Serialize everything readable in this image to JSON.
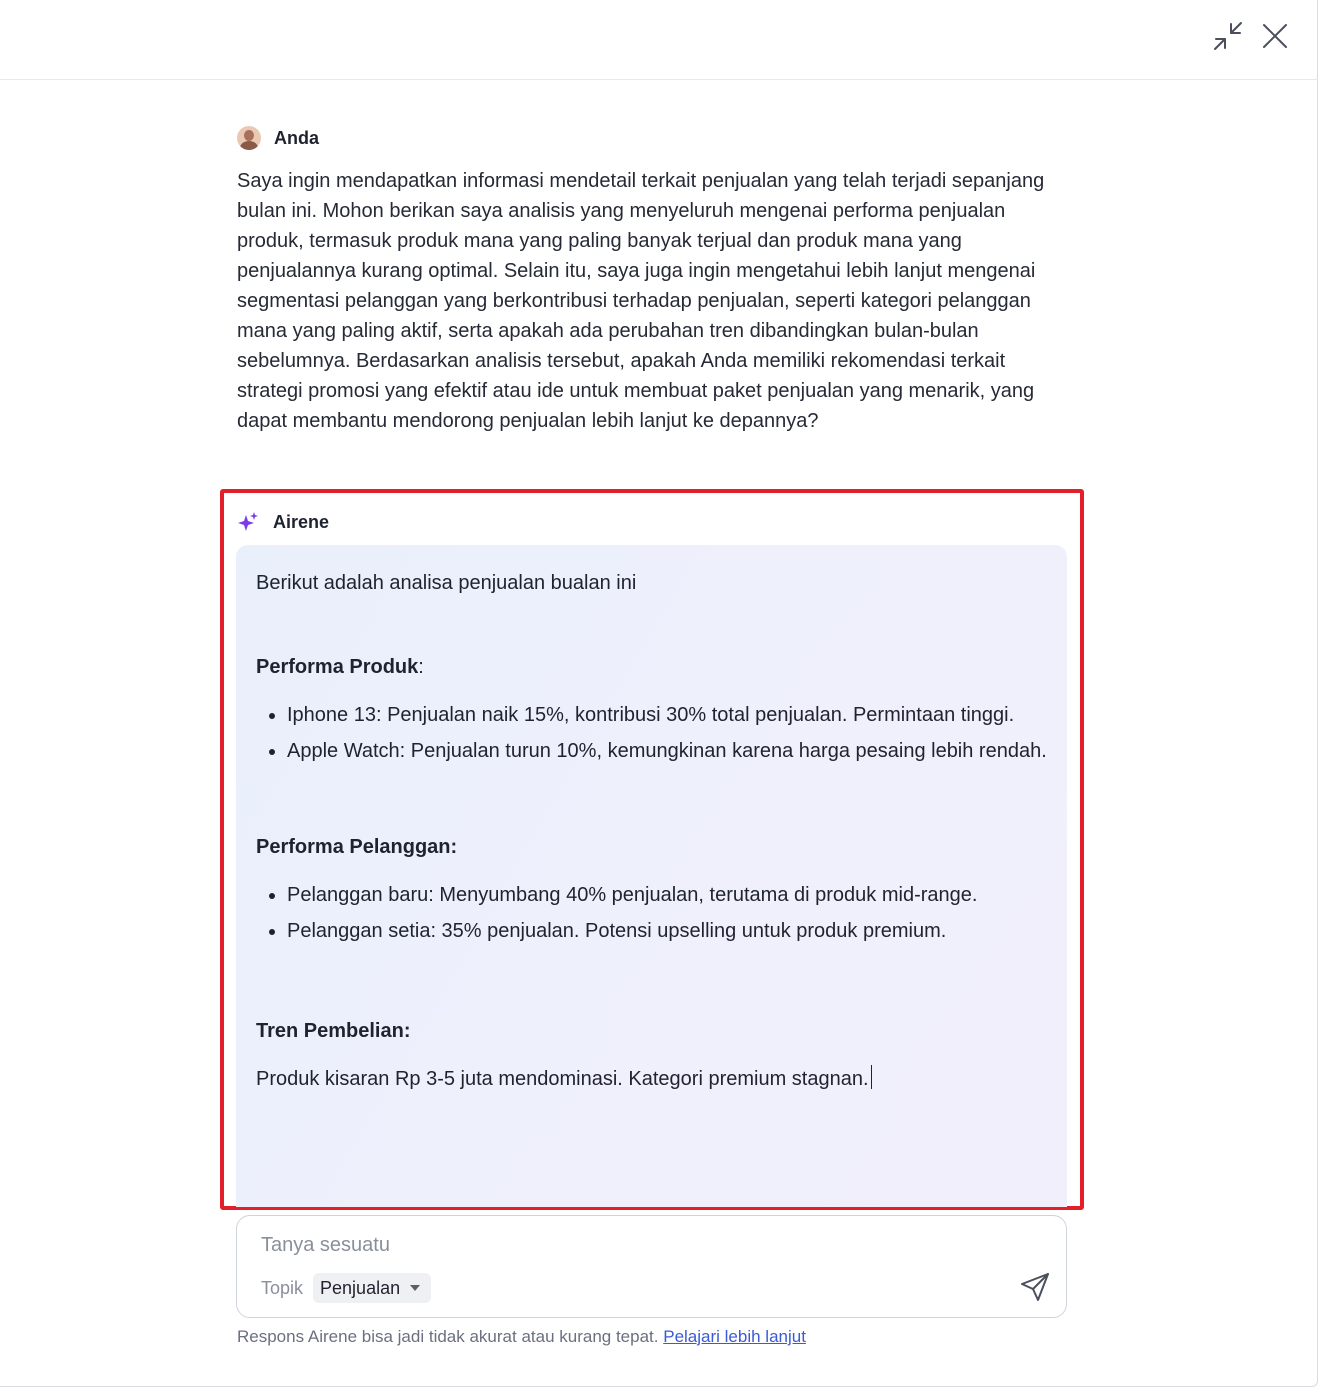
{
  "window": {
    "icons": {
      "minimize": "minimize-arrows-icon",
      "close": "close-icon"
    }
  },
  "user_message": {
    "sender": "Anda",
    "text": "Saya ingin mendapatkan informasi mendetail terkait penjualan yang telah terjadi sepanjang bulan ini. Mohon berikan saya analisis yang menyeluruh mengenai performa penjualan produk, termasuk produk mana yang paling banyak terjual dan produk mana yang penjualannya kurang optimal. Selain itu, saya juga ingin mengetahui lebih lanjut mengenai segmentasi pelanggan yang berkontribusi terhadap penjualan, seperti kategori pelanggan mana yang paling aktif, serta apakah ada perubahan tren dibandingkan bulan-bulan sebelumnya. Berdasarkan analisis tersebut, apakah Anda memiliki rekomendasi terkait strategi promosi yang efektif atau ide untuk membuat paket penjualan yang menarik, yang dapat membantu mendorong penjualan lebih lanjut ke depannya?"
  },
  "ai_message": {
    "sender": "Airene",
    "intro": "Berikut adalah analisa penjualan bualan ini",
    "section1": {
      "title": "Performa Produk",
      "suffix": ":",
      "items": [
        "Iphone 13: Penjualan naik 15%, kontribusi 30% total penjualan. Permintaan tinggi.",
        "Apple Watch: Penjualan turun 10%, kemungkinan karena harga pesaing lebih rendah."
      ]
    },
    "section2": {
      "title": "Performa Pelanggan:",
      "items": [
        "Pelanggan baru: Menyumbang 40% penjualan, terutama di produk mid-range.",
        "Pelanggan setia: 35% penjualan. Potensi upselling untuk produk premium."
      ]
    },
    "section3": {
      "title": "Tren Pembelian:",
      "text": "Produk kisaran Rp 3-5 juta mendominasi. Kategori premium stagnan."
    }
  },
  "composer": {
    "placeholder": "Tanya sesuatu",
    "topic_label": "Topik",
    "topic_value": "Penjualan"
  },
  "footer": {
    "disclaimer": "Respons Airene bisa jadi tidak akurat atau kurang tepat.",
    "link": "Pelajari lebih lanjut"
  },
  "colors": {
    "highlight_border": "#e3202a",
    "sparkle": "#7c3aed",
    "link": "#3b5bd6"
  }
}
